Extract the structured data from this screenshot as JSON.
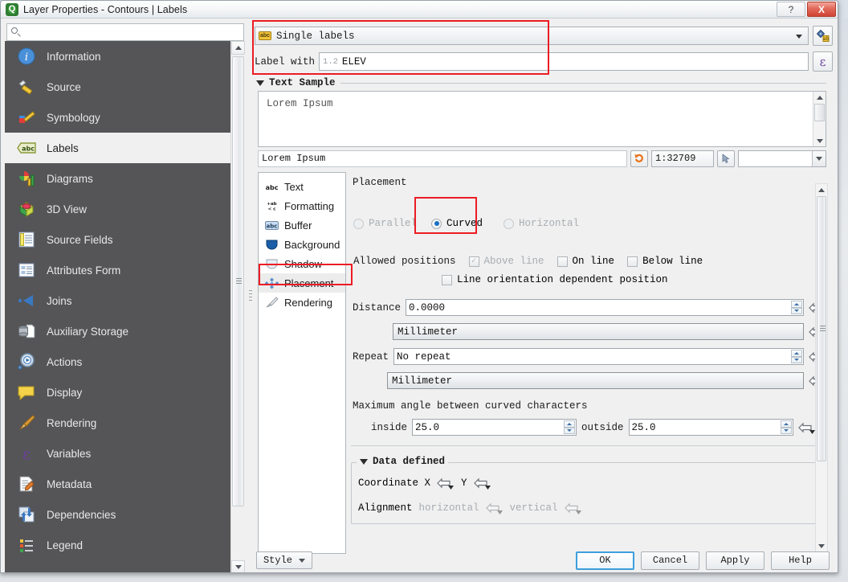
{
  "window": {
    "title": "Layer Properties - Contours | Labels",
    "app_icon": "qgis-icon",
    "help_button": "?",
    "close_button": "X"
  },
  "search": {
    "placeholder": "",
    "value": "",
    "icon": "search-icon"
  },
  "sidebar": {
    "items": [
      {
        "label": "Information",
        "icon": "information-icon",
        "active": false
      },
      {
        "label": "Source",
        "icon": "source-icon",
        "active": false
      },
      {
        "label": "Symbology",
        "icon": "symbology-icon",
        "active": false
      },
      {
        "label": "Labels",
        "icon": "labels-icon",
        "active": true
      },
      {
        "label": "Diagrams",
        "icon": "diagrams-icon",
        "active": false
      },
      {
        "label": "3D View",
        "icon": "3d-view-icon",
        "active": false
      },
      {
        "label": "Source Fields",
        "icon": "source-fields-icon",
        "active": false
      },
      {
        "label": "Attributes Form",
        "icon": "attributes-form-icon",
        "active": false
      },
      {
        "label": "Joins",
        "icon": "joins-icon",
        "active": false
      },
      {
        "label": "Auxiliary Storage",
        "icon": "auxiliary-storage-icon",
        "active": false
      },
      {
        "label": "Actions",
        "icon": "actions-icon",
        "active": false
      },
      {
        "label": "Display",
        "icon": "display-icon",
        "active": false
      },
      {
        "label": "Rendering",
        "icon": "rendering-icon",
        "active": false
      },
      {
        "label": "Variables",
        "icon": "variables-icon",
        "active": false
      },
      {
        "label": "Metadata",
        "icon": "metadata-icon",
        "active": false
      },
      {
        "label": "Dependencies",
        "icon": "dependencies-icon",
        "active": false
      },
      {
        "label": "Legend",
        "icon": "legend-icon",
        "active": false
      }
    ]
  },
  "labeling": {
    "mode": "Single labels",
    "mode_icon": "abc-badge-icon",
    "settings_button_icon": "labeling-settings-icon",
    "label_with_caption": "Label with",
    "label_with_field_type": "1.2",
    "label_with_value": "ELEV",
    "expression_button_icon": "epsilon-expression-icon"
  },
  "text_sample": {
    "group_title": "Text Sample",
    "sample_text": "Lorem Ipsum",
    "preview_text": "Lorem Ipsum",
    "revert_button_icon": "undo-arrow-icon",
    "scale": "1:32709",
    "pick_button_icon": "cursor-pick-icon",
    "background_combo_value": ""
  },
  "sub_tabs": [
    {
      "label": "Text",
      "icon": "text-abc-icon",
      "active": false
    },
    {
      "label": "Formatting",
      "icon": "formatting-icon",
      "active": false
    },
    {
      "label": "Buffer",
      "icon": "buffer-abc-icon",
      "active": false
    },
    {
      "label": "Background",
      "icon": "background-shield-icon",
      "active": false
    },
    {
      "label": "Shadow",
      "icon": "shadow-shield-icon",
      "active": false
    },
    {
      "label": "Placement",
      "icon": "placement-diamond-icon",
      "active": true
    },
    {
      "label": "Rendering",
      "icon": "rendering-brush-icon",
      "active": false
    }
  ],
  "placement": {
    "section_label": "Placement",
    "modes": [
      {
        "label": "Parallel",
        "selected": false,
        "disabled": true
      },
      {
        "label": "Curved",
        "selected": true,
        "disabled": false
      },
      {
        "label": "Horizontal",
        "selected": false,
        "disabled": true
      }
    ],
    "allowed_positions_label": "Allowed positions",
    "allowed_positions": [
      {
        "label": "Above line",
        "checked": true,
        "disabled": true
      },
      {
        "label": "On line",
        "checked": false,
        "disabled": false
      },
      {
        "label": "Below line",
        "checked": false,
        "disabled": false
      }
    ],
    "line_orientation": {
      "label": "Line orientation dependent position",
      "checked": false
    },
    "distance_label": "Distance",
    "distance_value": "0.0000",
    "distance_unit": "Millimeter",
    "repeat_label": "Repeat",
    "repeat_value": "No repeat",
    "repeat_unit": "Millimeter",
    "max_angle_label": "Maximum angle between curved characters",
    "inside_label": "inside",
    "inside_value": "25.0",
    "outside_label": "outside",
    "outside_value": "25.0",
    "data_defined": {
      "group_title": "Data defined",
      "coordinate_label": "Coordinate X",
      "coordinate_y_label": "Y",
      "alignment_label": "Alignment",
      "alignment_horizontal": "horizontal",
      "alignment_vertical": "vertical"
    },
    "override_icon": "data-defined-override-icon"
  },
  "footer": {
    "style_button": "Style",
    "ok_button": "OK",
    "cancel_button": "Cancel",
    "apply_button": "Apply",
    "help_button": "Help"
  },
  "colors": {
    "sidebar_bg": "#555557",
    "panel_bg": "#f0f0f0",
    "highlight_red": "#ec1c24",
    "accent_blue": "#3b9fdc",
    "radio_selected": "#1a6fc4"
  }
}
